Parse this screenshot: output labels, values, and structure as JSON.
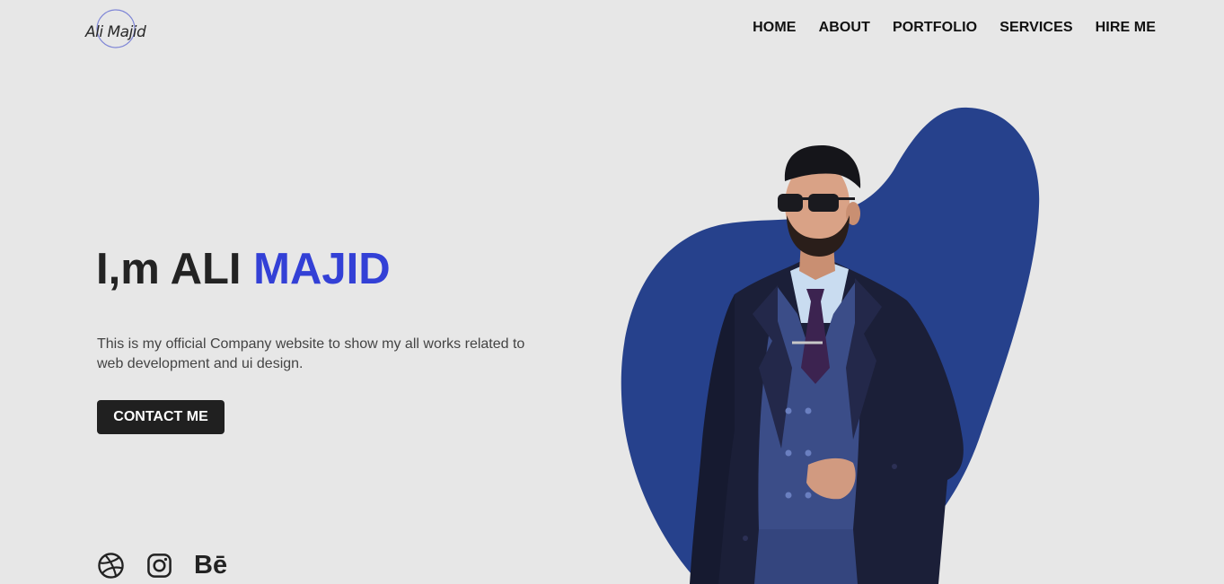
{
  "brand": {
    "logo_text": "Ali Majid"
  },
  "nav": {
    "items": [
      {
        "label": "HOME"
      },
      {
        "label": "ABOUT"
      },
      {
        "label": "PORTFOLIO"
      },
      {
        "label": "SERVICES"
      },
      {
        "label": "HIRE ME"
      }
    ]
  },
  "hero": {
    "title_prefix": "I,m ALI ",
    "title_accent": "MAJID",
    "description": "This is my official Company website to show my all works related to web development and ui design.",
    "cta_label": "CONTACT ME",
    "social_icons": [
      "dribbble-icon",
      "instagram-icon",
      "behance-icon"
    ],
    "behance_glyph": "Bē"
  },
  "colors": {
    "background": "#e7e7e7",
    "accent": "#3340d6",
    "blob": "#26418c",
    "button": "#202020"
  }
}
